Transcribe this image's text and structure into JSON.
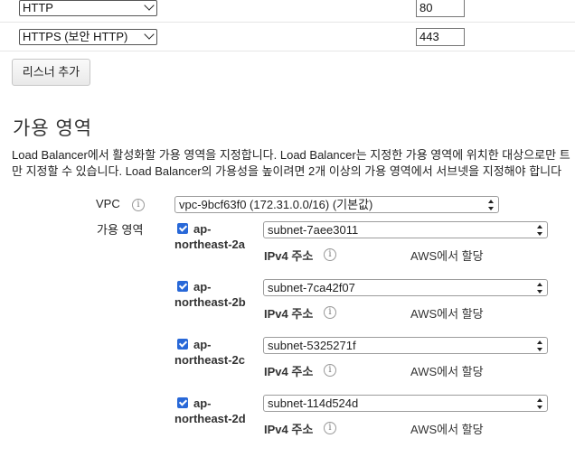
{
  "listeners": [
    {
      "protocol": "HTTP",
      "port": "80"
    },
    {
      "protocol": "HTTPS (보안 HTTP)",
      "port": "443"
    }
  ],
  "add_listener_label": "리스너 추가",
  "availability_zones": {
    "title": "가용 영역",
    "description_line1": "Load Balancer에서 활성화할 가용 영역을 지정합니다. Load Balancer는 지정한 가용 영역에 위치한 대상으로만 트",
    "description_line2": "만 지정할 수 있습니다. Load Balancer의 가용성을 높이려면 2개 이상의 가용 영역에서 서브넷을 지정해야 합니다",
    "vpc_label": "VPC",
    "vpc_value": "vpc-9bcf63f0 (172.31.0.0/16) (기본값)",
    "az_label": "가용 영역",
    "info_glyph": "i",
    "zones": [
      {
        "name_line1": "ap-",
        "name_line2": "northeast-2a",
        "subnet": "subnet-7aee3011",
        "ipv4_label": "IPv4 주소",
        "ipv4_value": "AWS에서 할당",
        "checked": true
      },
      {
        "name_line1": "ap-",
        "name_line2": "northeast-2b",
        "subnet": "subnet-7ca42f07",
        "ipv4_label": "IPv4 주소",
        "ipv4_value": "AWS에서 할당",
        "checked": true
      },
      {
        "name_line1": "ap-",
        "name_line2": "northeast-2c",
        "subnet": "subnet-5325271f",
        "ipv4_label": "IPv4 주소",
        "ipv4_value": "AWS에서 할당",
        "checked": true
      },
      {
        "name_line1": "ap-",
        "name_line2": "northeast-2d",
        "subnet": "subnet-114d524d",
        "ipv4_label": "IPv4 주소",
        "ipv4_value": "AWS에서 할당",
        "checked": true
      }
    ]
  },
  "colors": {
    "checkbox": "#2868d8",
    "row_divider": "#e6e6e6"
  }
}
